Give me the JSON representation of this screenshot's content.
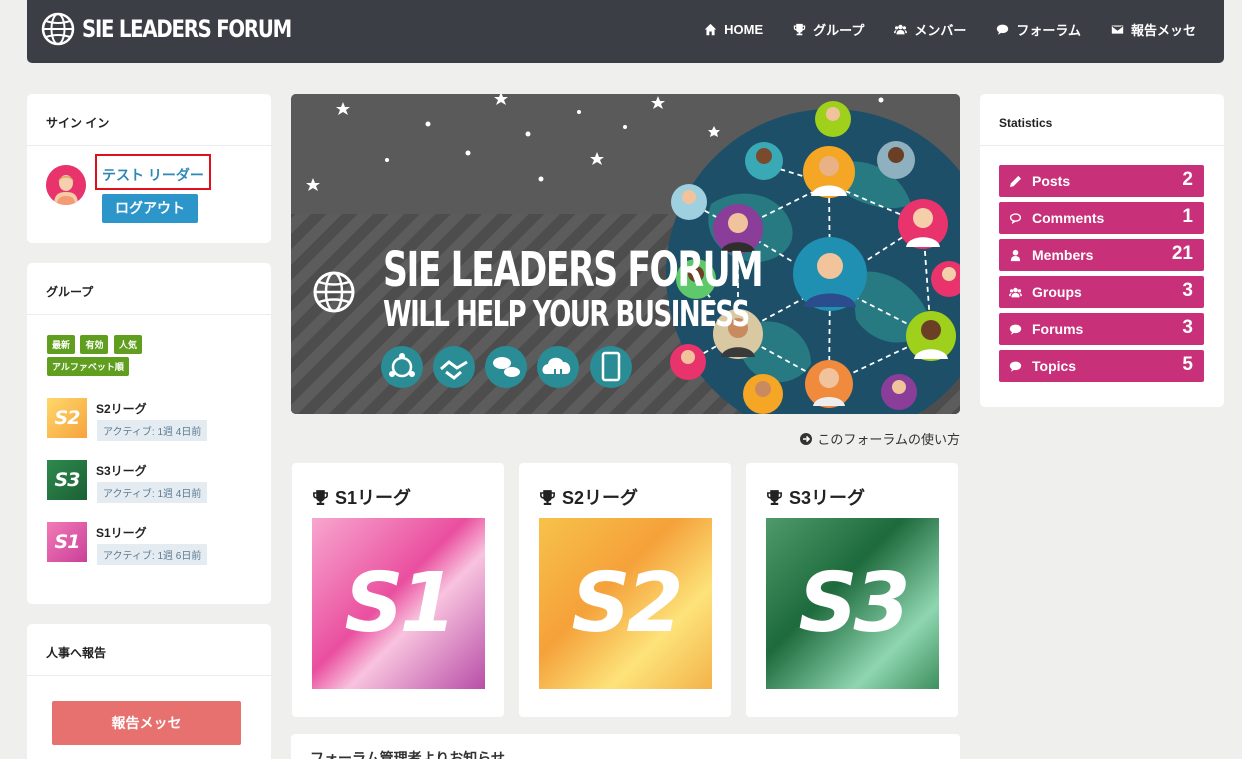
{
  "header": {
    "logo_text": "SIE LEADERS FORUM",
    "nav": [
      {
        "label": "HOME",
        "icon": "home-icon"
      },
      {
        "label": "グループ",
        "icon": "trophy-icon"
      },
      {
        "label": "メンバー",
        "icon": "users-icon"
      },
      {
        "label": "フォーラム",
        "icon": "chat-icon"
      },
      {
        "label": "報告メッセ",
        "icon": "envelope-icon"
      }
    ]
  },
  "signin": {
    "title": "サイン イン",
    "user_name": "テスト リーダー",
    "logout_label": "ログアウト"
  },
  "groups": {
    "title": "グループ",
    "filters": [
      "最新",
      "有効",
      "人気",
      "アルファベット順"
    ],
    "items": [
      {
        "name": "S2リーグ",
        "thumb": "S2",
        "active": "アクティブ: 1週 4日前"
      },
      {
        "name": "S3リーグ",
        "thumb": "S3",
        "active": "アクティブ: 1週 4日前"
      },
      {
        "name": "S1リーグ",
        "thumb": "S1",
        "active": "アクティブ: 1週 6日前"
      }
    ]
  },
  "report": {
    "title": "人事へ報告",
    "button_label": "報告メッセ"
  },
  "banner": {
    "line1": "SIE LEADERS FORUM",
    "line2": "WILL HELP YOUR BUSINESS"
  },
  "help_link": "このフォーラムの使い方",
  "leagues": [
    {
      "title": "S1リーグ",
      "image_text": "S1"
    },
    {
      "title": "S2リーグ",
      "image_text": "S2"
    },
    {
      "title": "S3リーグ",
      "image_text": "S3"
    }
  ],
  "notice": {
    "title": "フォーラム管理者よりお知らせ"
  },
  "stats": {
    "title": "Statistics",
    "items": [
      {
        "label": "Posts",
        "value": "2",
        "icon": "pencil-icon"
      },
      {
        "label": "Comments",
        "value": "1",
        "icon": "comment-icon"
      },
      {
        "label": "Members",
        "value": "21",
        "icon": "user-icon"
      },
      {
        "label": "Groups",
        "value": "3",
        "icon": "users-icon"
      },
      {
        "label": "Forums",
        "value": "3",
        "icon": "chat-icon"
      },
      {
        "label": "Topics",
        "value": "5",
        "icon": "chat-icon"
      }
    ]
  },
  "colors": {
    "header_bg": "#3c3e45",
    "stat_bg": "#c8307a",
    "logout_bg": "#2c95c9",
    "report_bg": "#e7716f",
    "filter_bg": "#5f9e1f"
  }
}
